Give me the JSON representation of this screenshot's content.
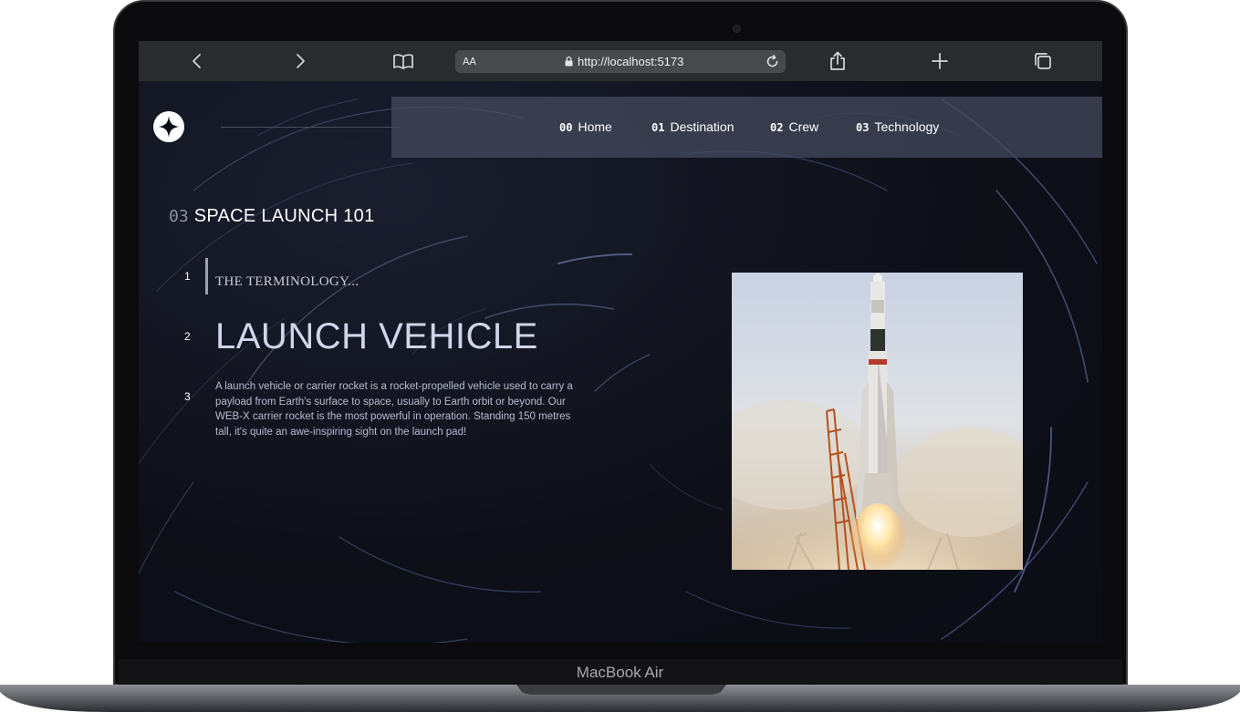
{
  "device": {
    "label": "MacBook Air"
  },
  "browser": {
    "aa_label": "AA",
    "url": "http://localhost:5173"
  },
  "nav": {
    "items": [
      {
        "num": "00",
        "label": "Home"
      },
      {
        "num": "01",
        "label": "Destination"
      },
      {
        "num": "02",
        "label": "Crew"
      },
      {
        "num": "03",
        "label": "Technology"
      }
    ]
  },
  "section": {
    "num": "03",
    "title": "SPACE LAUNCH 101"
  },
  "steps": [
    "1",
    "2",
    "3"
  ],
  "content": {
    "terminology": "THE TERMINOLOGY...",
    "title": "LAUNCH VEHICLE",
    "description": "A launch vehicle or carrier rocket is a rocket-propelled vehicle used to carry a payload from Earth's surface to space, usually to Earth orbit or beyond. Our WEB-X carrier rocket is the most powerful in operation. Standing 150 metres tall, it's quite an awe-inspiring sight on the launch pad!"
  },
  "colors": {
    "background": "#0d0f1a",
    "navbar": "#464c60",
    "accent": "#d0d6ea"
  }
}
